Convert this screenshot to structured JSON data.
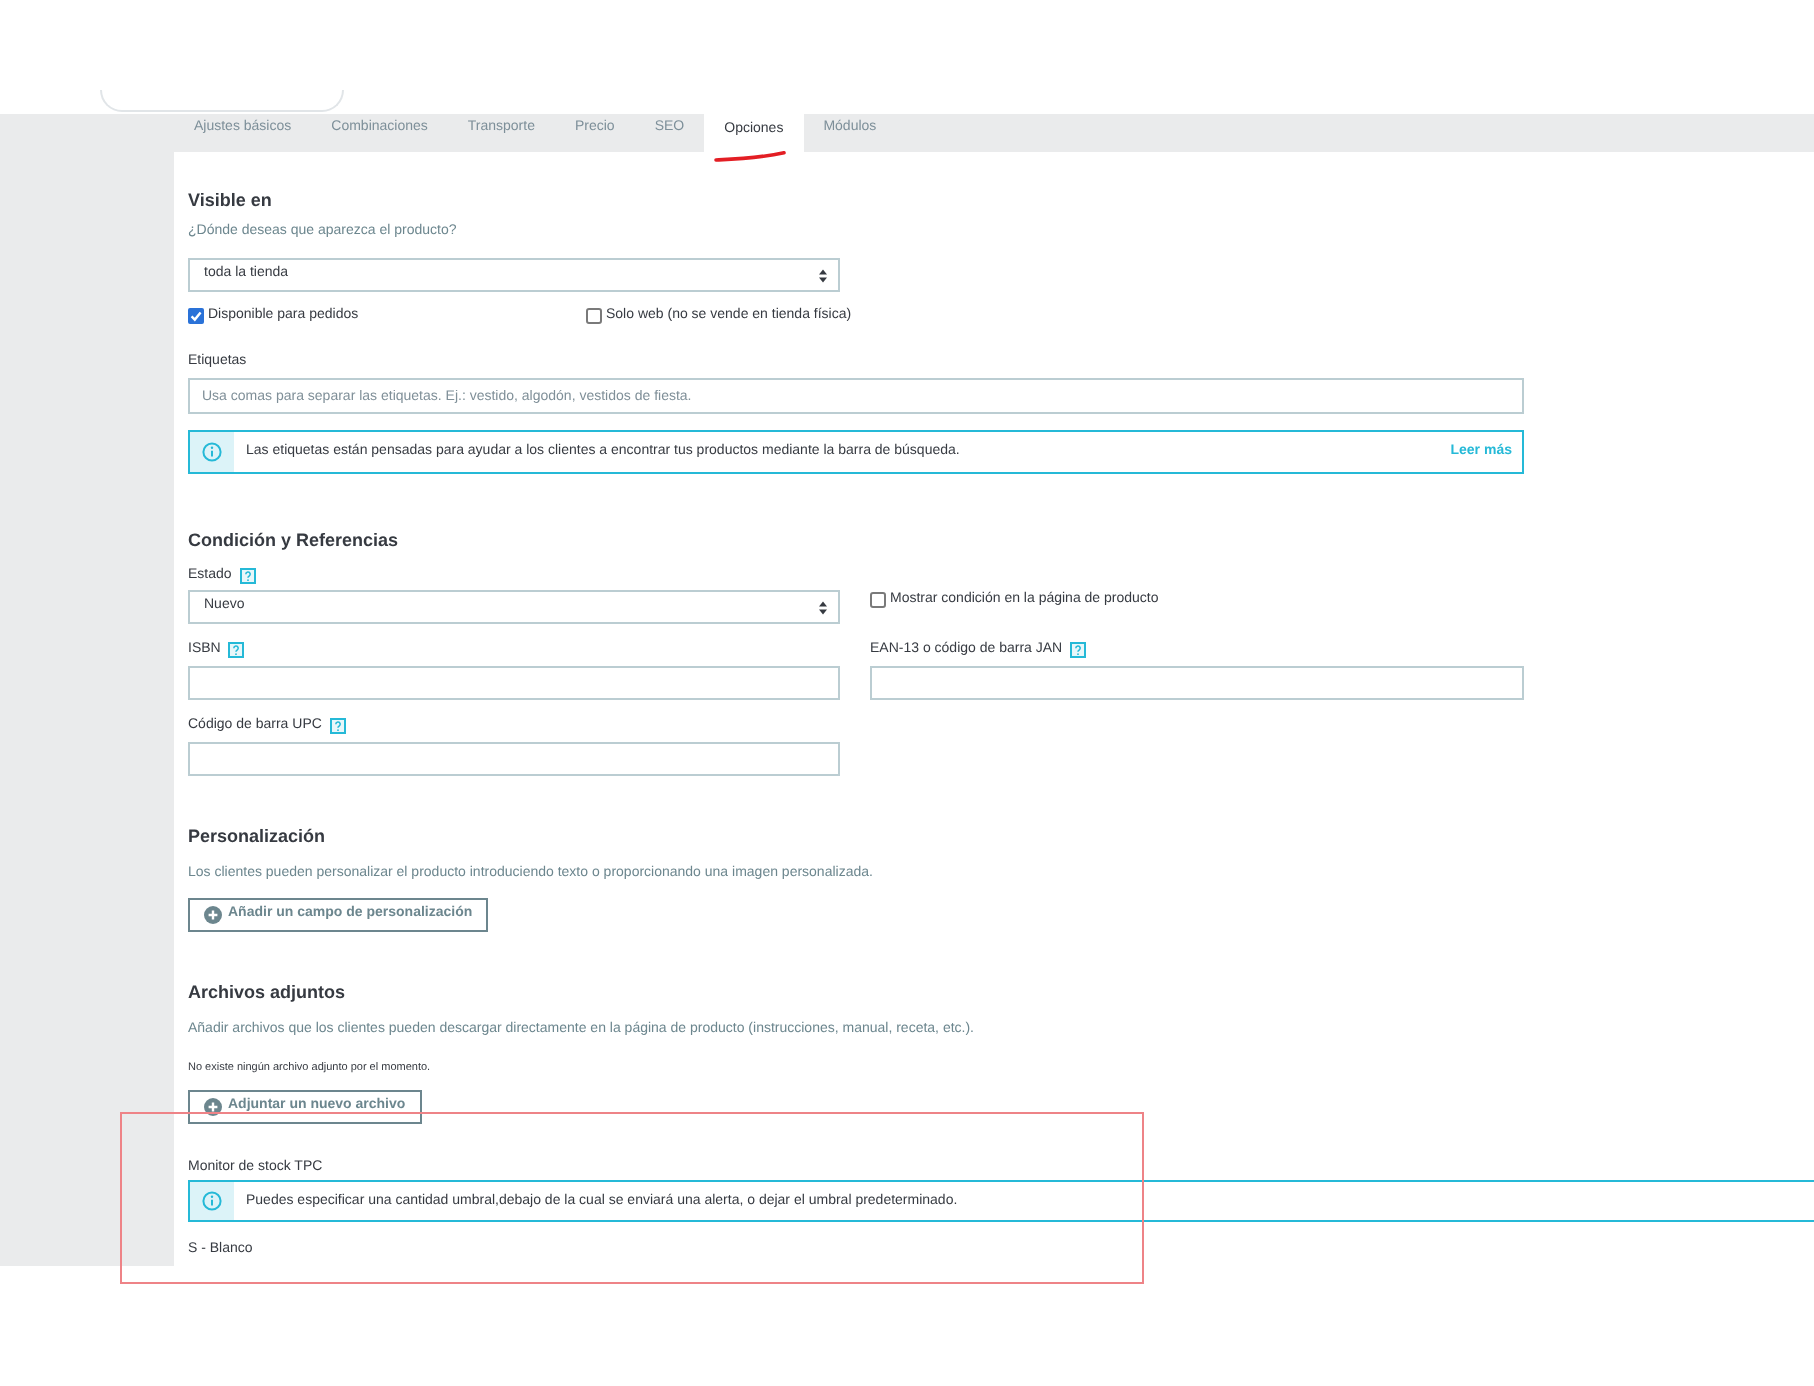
{
  "tabs": [
    {
      "label": "Ajustes básicos",
      "selected": false
    },
    {
      "label": "Combinaciones",
      "selected": false
    },
    {
      "label": "Transporte",
      "selected": false
    },
    {
      "label": "Precio",
      "selected": false
    },
    {
      "label": "SEO",
      "selected": false
    },
    {
      "label": "Opciones",
      "selected": true
    },
    {
      "label": "Módulos",
      "selected": false
    }
  ],
  "visibility": {
    "title": "Visible en",
    "question": "¿Dónde deseas que aparezca el producto?",
    "select": {
      "value": "toda la tienda"
    },
    "checkboxes": [
      {
        "label": "Disponible para pedidos",
        "checked": true
      },
      {
        "label": "Solo web (no se vende en tienda física)",
        "checked": false
      }
    ]
  },
  "tags": {
    "label": "Etiquetas",
    "input": {
      "placeholder": "Usa comas para separar las etiquetas. Ej.: vestido, algodón, vestidos de fiesta."
    },
    "info": {
      "text": "Las etiquetas están pensadas para ayudar a los clientes a encontrar tus productos mediante la barra de búsqueda.",
      "link": "Leer más"
    }
  },
  "condition": {
    "title": "Condición y Referencias",
    "fields": [
      {
        "kind": "select",
        "label": "Estado",
        "help": true,
        "value": "Nuevo"
      },
      {
        "kind": "checkbox",
        "label": "Mostrar condición en la página de producto",
        "checked": false
      },
      {
        "kind": "input",
        "label": "ISBN",
        "help": true
      },
      {
        "kind": "input",
        "label": "EAN-13 o código de barra JAN",
        "help": true
      },
      {
        "kind": "input",
        "label": "Código de barra UPC",
        "help": true
      }
    ]
  },
  "customization": {
    "title": "Personalización",
    "description": "Los clientes pueden personalizar el producto introduciendo texto o proporcionando una imagen personalizada.",
    "button": "Añadir un campo de personalización"
  },
  "attachments": {
    "title": "Archivos adjuntos",
    "description": "Añadir archivos que los clientes pueden descargar directamente en la página de producto (instrucciones, manual, receta, etc.).",
    "empty_note": "No existe ningún archivo adjunto por el momento.",
    "button": "Adjuntar un nuevo archivo"
  },
  "stock_monitor": {
    "label": "Monitor de stock TPC",
    "info": {
      "text": "Puedes especificar una cantidad umbral,debajo de la cual se enviará una alerta, o dejar el umbral predeterminado."
    },
    "item": "S - Blanco"
  }
}
